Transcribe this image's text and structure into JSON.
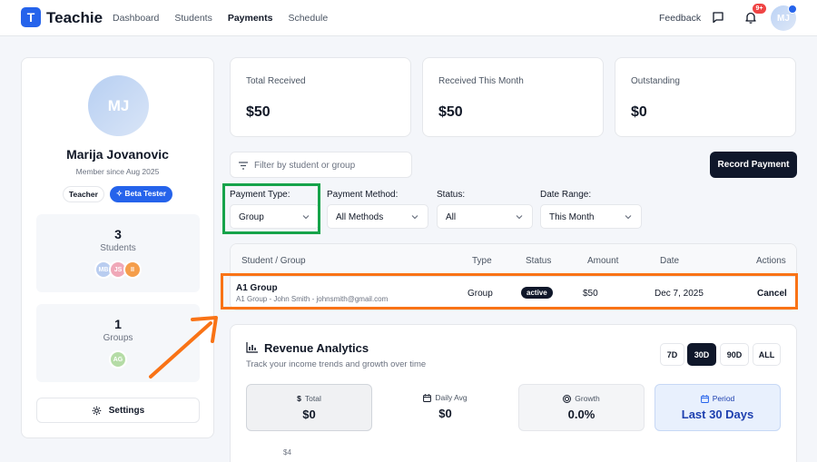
{
  "header": {
    "logo_letter": "T",
    "app_name": "Teachie",
    "nav": [
      "Dashboard",
      "Students",
      "Payments",
      "Schedule"
    ],
    "active_nav": "Payments",
    "feedback": "Feedback",
    "notification_count": "9+",
    "avatar_initials": "MJ",
    "icons": [
      "message-icon",
      "bell-icon"
    ]
  },
  "profile": {
    "avatar_initials": "MJ",
    "name": "Marija Jovanovic",
    "member_since": "Member since Aug 2025",
    "badges": {
      "teacher": "Teacher",
      "beta": "Beta Tester"
    },
    "students": {
      "count": "3",
      "label": "Students",
      "avatars": [
        "MB",
        "JS",
        "II"
      ]
    },
    "groups": {
      "count": "1",
      "label": "Groups",
      "avatars": [
        "AG"
      ]
    },
    "settings_label": "Settings"
  },
  "summary": [
    {
      "label": "Total Received",
      "value": "$50"
    },
    {
      "label": "Received This Month",
      "value": "$50"
    },
    {
      "label": "Outstanding",
      "value": "$0"
    }
  ],
  "filters": {
    "search_placeholder": "Filter by student or group",
    "record_button": "Record Payment",
    "payment_type": {
      "label": "Payment Type:",
      "value": "Group"
    },
    "payment_method": {
      "label": "Payment Method:",
      "value": "All Methods"
    },
    "status": {
      "label": "Status:",
      "value": "All"
    },
    "date_range": {
      "label": "Date Range:",
      "value": "This Month"
    }
  },
  "table": {
    "headers": {
      "student": "Student / Group",
      "type": "Type",
      "status": "Status",
      "amount": "Amount",
      "date": "Date",
      "actions": "Actions"
    },
    "rows": [
      {
        "name": "A1 Group",
        "sub": "A1 Group - John Smith - johnsmith@gmail.com",
        "type": "Group",
        "status": "active",
        "amount": "$50",
        "date": "Dec 7, 2025",
        "action": "Cancel"
      }
    ]
  },
  "analytics": {
    "title": "Revenue Analytics",
    "subtitle": "Track your income trends and growth over time",
    "ranges": [
      "7D",
      "30D",
      "90D",
      "ALL"
    ],
    "active_range": "30D",
    "metrics": {
      "total": {
        "label": "Total",
        "value": "$0"
      },
      "daily": {
        "label": "Daily Avg",
        "value": "$0"
      },
      "growth": {
        "label": "Growth",
        "value": "0.0%"
      },
      "period": {
        "label": "Period",
        "value": "Last 30 Days"
      }
    },
    "y_tick": "$4"
  },
  "colors": {
    "primary": "#2563eb",
    "dark": "#0f172a",
    "highlight_green": "#16a34a",
    "highlight_orange": "#f97316"
  }
}
